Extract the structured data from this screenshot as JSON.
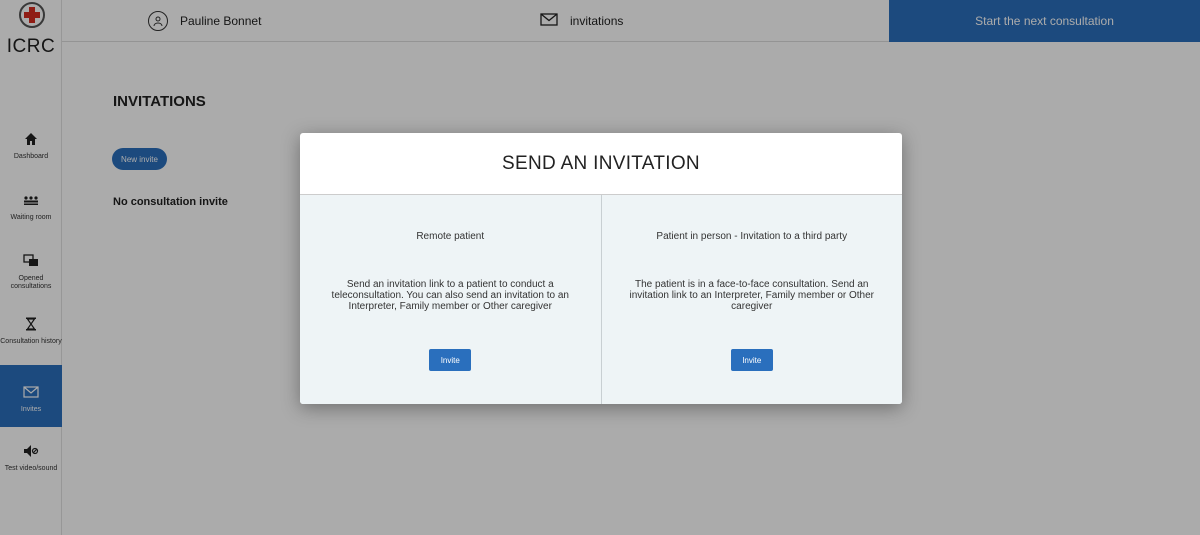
{
  "app": {
    "name": "ICRC"
  },
  "sidebar": {
    "items": [
      {
        "label": "Dashboard",
        "icon": "home-icon"
      },
      {
        "label": "Waiting room",
        "icon": "people-icon"
      },
      {
        "label": "Opened consultations",
        "icon": "chat-icon"
      },
      {
        "label": "Consultation history",
        "icon": "hourglass-icon"
      },
      {
        "label": "Invites",
        "icon": "envelope-icon",
        "active": true
      },
      {
        "label": "Test video/sound",
        "icon": "speaker-icon"
      }
    ]
  },
  "header": {
    "user_name": "Pauline Bonnet",
    "invitations_label": "invitations",
    "next_consultation_label": "Start the next consultation"
  },
  "main": {
    "title": "INVITATIONS",
    "new_invite_label": "New invite",
    "empty_message": "No consultation invite"
  },
  "modal": {
    "title": "SEND AN INVITATION",
    "options": [
      {
        "title": "Remote patient",
        "description": "Send an invitation link to a patient to conduct a teleconsultation. You can also send an invitation to an Interpreter, Family member or Other caregiver",
        "button_label": "Invite"
      },
      {
        "title": "Patient in person - Invitation to a third party",
        "description": "The patient is in a face-to-face consultation. Send an invitation link to an Interpreter, Family member or Other caregiver",
        "button_label": "Invite"
      }
    ]
  },
  "colors": {
    "accent": "#2a6fbd",
    "brand_red": "#d52b1e",
    "panel_bg": "#eef4f6"
  }
}
